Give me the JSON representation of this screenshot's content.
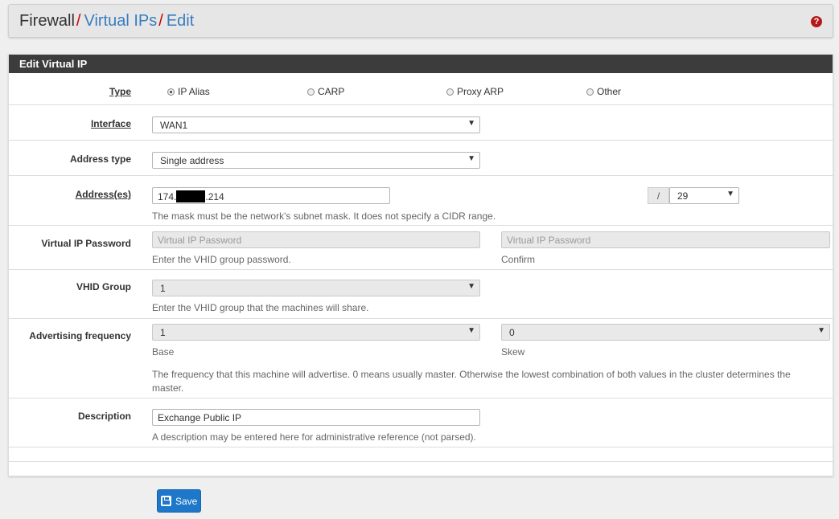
{
  "breadcrumb": {
    "root": "Firewall",
    "sep1": "/",
    "virtual_ips": "Virtual IPs",
    "sep2": "/",
    "current": "Edit",
    "help_glyph": "?"
  },
  "panel": {
    "title": "Edit Virtual IP"
  },
  "type": {
    "label": "Type",
    "options": [
      "IP Alias",
      "CARP",
      "Proxy ARP",
      "Other"
    ],
    "selected": "IP Alias"
  },
  "interface": {
    "label": "Interface",
    "value": "WAN1"
  },
  "address_type": {
    "label": "Address type",
    "value": "Single address"
  },
  "addresses": {
    "label": "Address(es)",
    "prefix": "174.",
    "suffix": ".214",
    "slash": "/",
    "mask": "29",
    "help": "The mask must be the network's subnet mask. It does not specify a CIDR range."
  },
  "vip_password": {
    "label": "Virtual IP Password",
    "placeholder": "Virtual IP Password",
    "confirm_placeholder": "Virtual IP Password",
    "help": "Enter the VHID group password.",
    "confirm_help": "Confirm"
  },
  "vhid_group": {
    "label": "VHID Group",
    "value": "1",
    "help": "Enter the VHID group that the machines will share."
  },
  "advertising": {
    "label": "Advertising frequency",
    "base_value": "1",
    "skew_value": "0",
    "base_help": "Base",
    "skew_help": "Skew",
    "help_line1": "The frequency that this machine will advertise. 0 means usually master. Otherwise the lowest combination of both values in the cluster determines the",
    "help_line2": "master."
  },
  "description": {
    "label": "Description",
    "value": "Exchange Public IP",
    "help": "A description may be entered here for administrative reference (not parsed)."
  },
  "save_button": {
    "label": "Save"
  },
  "icons": {
    "help": "question-circle-icon",
    "save": "floppy-disk-icon",
    "select": "caret-down-icon"
  },
  "colors": {
    "accent": "#1e77c9",
    "heading": "#3c3c3c",
    "link": "#3a7dbf",
    "separator": "#cc0000"
  }
}
